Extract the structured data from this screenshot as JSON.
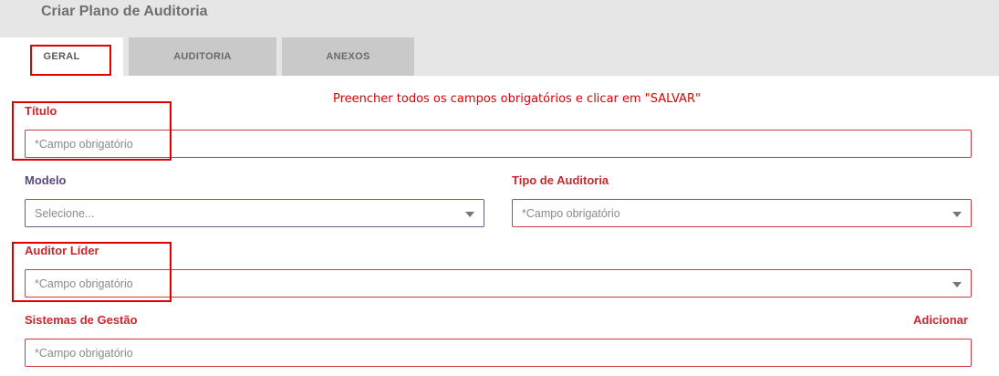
{
  "header": {
    "title": "Criar Plano de Auditoria"
  },
  "tabs": [
    {
      "label": "GERAL",
      "active": true
    },
    {
      "label": "AUDITORIA",
      "active": false
    },
    {
      "label": "ANEXOS",
      "active": false
    }
  ],
  "notice": "Preencher todos os campos obrigatórios e clicar em \"SALVAR\"",
  "form": {
    "titulo": {
      "label": "Título",
      "placeholder": "*Campo obrigatório"
    },
    "modelo": {
      "label": "Modelo",
      "value": "Selecione..."
    },
    "tipo_auditoria": {
      "label": "Tipo de Auditoria",
      "value": "*Campo obrigatório"
    },
    "auditor_lider": {
      "label": "Auditor Líder",
      "value": "*Campo obrigatório"
    },
    "sistemas_gestao": {
      "label": "Sistemas de Gestão",
      "placeholder": "*Campo obrigatório",
      "add_label": "Adicionar"
    }
  },
  "colors": {
    "required": "#c8282e",
    "optional": "#5a4a7a",
    "highlight": "#e00000",
    "header_bg": "#e6e6e6",
    "tab_inactive": "#c9c9c9"
  }
}
